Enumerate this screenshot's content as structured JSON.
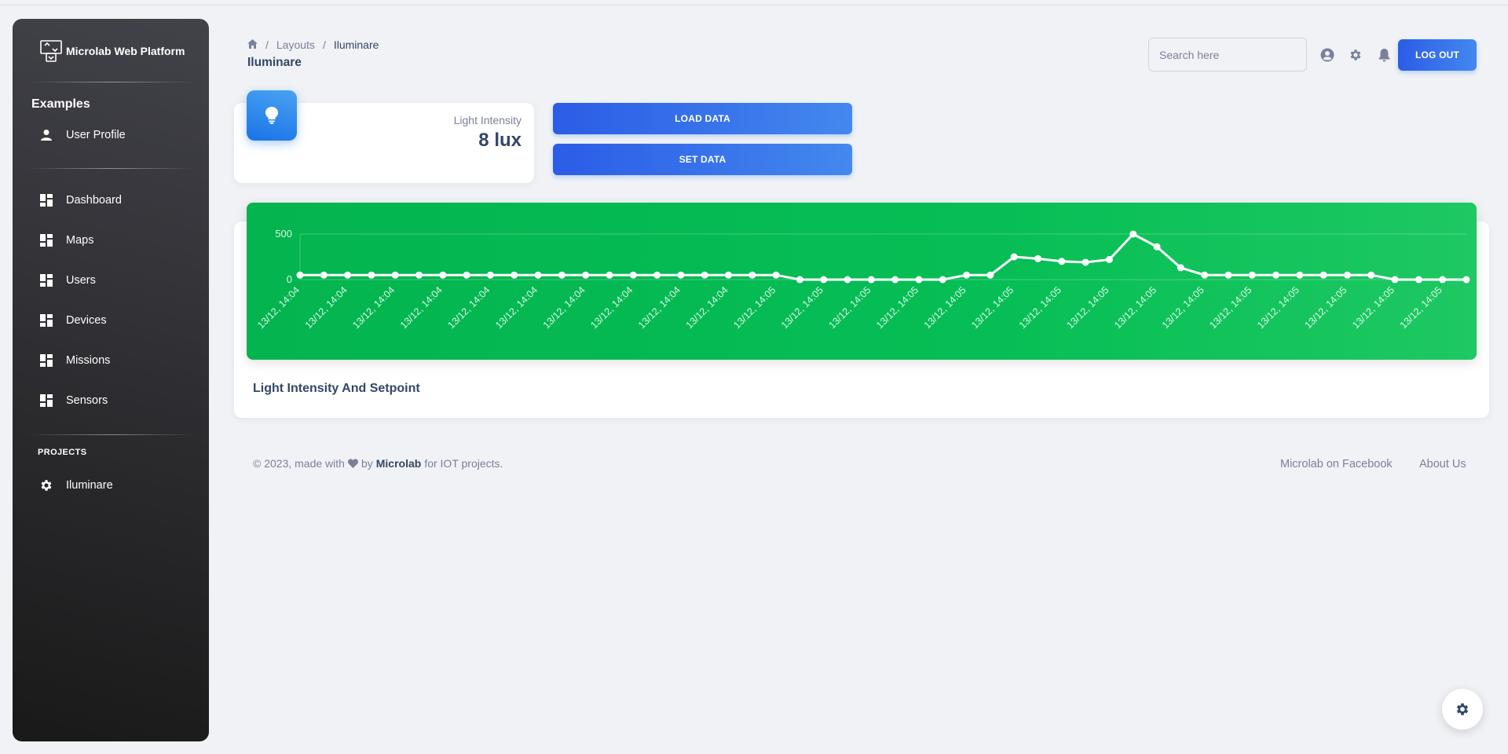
{
  "sidebar": {
    "brand": "Microlab Web Platform",
    "section": "Examples",
    "profile": {
      "label": "User Profile",
      "icon": "person-icon"
    },
    "items": [
      {
        "label": "Dashboard",
        "icon": "dashboard-icon"
      },
      {
        "label": "Maps",
        "icon": "dashboard-icon"
      },
      {
        "label": "Users",
        "icon": "dashboard-icon"
      },
      {
        "label": "Devices",
        "icon": "dashboard-icon"
      },
      {
        "label": "Missions",
        "icon": "dashboard-icon"
      },
      {
        "label": "Sensors",
        "icon": "dashboard-icon"
      }
    ],
    "projects_heading": "PROJECTS",
    "projects": [
      {
        "label": "Iluminare",
        "icon": "gear-icon"
      }
    ]
  },
  "header": {
    "breadcrumb": {
      "parent": "Layouts",
      "current": "Iluminare"
    },
    "title": "Iluminare",
    "search_placeholder": "Search here",
    "logout_label": "LOG OUT"
  },
  "stat": {
    "label": "Light Intensity",
    "value": "8 lux",
    "icon": "lightbulb-icon"
  },
  "actions": {
    "load_label": "LOAD DATA",
    "set_label": "SET DATA"
  },
  "chart": {
    "title": "Light Intensity And Setpoint"
  },
  "chart_data": {
    "type": "line",
    "title": "",
    "xlabel": "",
    "ylabel": "",
    "y_ticks": [
      "500",
      "0"
    ],
    "ylim": [
      0,
      500
    ],
    "grid": true,
    "x": [
      "13/12, 14:04",
      "13/12, 14:04",
      "13/12, 14:04",
      "13/12, 14:04",
      "13/12, 14:04",
      "13/12, 14:04",
      "13/12, 14:04",
      "13/12, 14:04",
      "13/12, 14:04",
      "13/12, 14:04",
      "13/12, 14:04",
      "13/12, 14:04",
      "13/12, 14:04",
      "13/12, 14:04",
      "13/12, 14:04",
      "13/12, 14:04",
      "13/12, 14:04",
      "13/12, 14:04",
      "13/12, 14:04",
      "13/12, 14:04",
      "13/12, 14:05",
      "13/12, 14:05",
      "13/12, 14:05",
      "13/12, 14:05",
      "13/12, 14:05",
      "13/12, 14:05",
      "13/12, 14:05",
      "13/12, 14:05",
      "13/12, 14:05",
      "13/12, 14:05",
      "13/12, 14:05",
      "13/12, 14:05",
      "13/12, 14:05",
      "13/12, 14:05",
      "13/12, 14:05",
      "13/12, 14:05",
      "13/12, 14:05",
      "13/12, 14:05",
      "13/12, 14:05",
      "13/12, 14:05",
      "13/12, 14:05",
      "13/12, 14:05",
      "13/12, 14:05",
      "13/12, 14:05",
      "13/12, 14:05",
      "13/12, 14:05",
      "13/12, 14:05",
      "13/12, 14:05",
      "13/12, 14:05",
      "13/12, 14:05"
    ],
    "series": [
      {
        "name": "",
        "values": [
          50,
          50,
          50,
          50,
          50,
          50,
          50,
          50,
          50,
          50,
          50,
          50,
          50,
          50,
          50,
          50,
          50,
          50,
          50,
          50,
          50,
          0,
          0,
          0,
          0,
          0,
          0,
          0,
          50,
          50,
          250,
          230,
          200,
          190,
          220,
          500,
          360,
          130,
          50,
          50,
          50,
          50,
          50,
          50,
          50,
          50,
          0,
          0,
          0,
          0
        ]
      }
    ],
    "color": "#ffffff"
  },
  "footer": {
    "prefix": "© 2023, made with",
    "by": "by",
    "brand": "Microlab",
    "suffix": "for IOT projects.",
    "links": [
      "Microlab on Facebook",
      "About Us"
    ]
  }
}
